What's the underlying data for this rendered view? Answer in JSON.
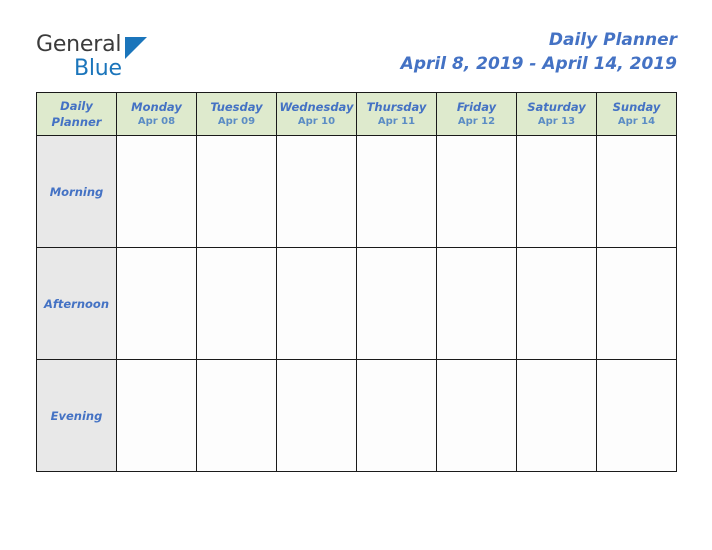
{
  "brand": {
    "logo_text_primary": "General",
    "logo_text_secondary": "Blue",
    "logo_accent_color": "#1b75bb",
    "logo_primary_color": "#3b3b3b",
    "triangle_icon": "blue-triangle-icon"
  },
  "header": {
    "title": "Daily Planner",
    "date_range": "April 8, 2019 - April 14, 2019",
    "title_color": "#4472c4"
  },
  "table": {
    "corner_label_line1": "Daily",
    "corner_label_line2": "Planner",
    "header_background": "#deeacd",
    "row_label_background": "#e8e8e8",
    "border_color": "#1a1a1a",
    "columns": [
      {
        "day": "Monday",
        "date": "Apr 08"
      },
      {
        "day": "Tuesday",
        "date": "Apr 09"
      },
      {
        "day": "Wednesday",
        "date": "Apr 10"
      },
      {
        "day": "Thursday",
        "date": "Apr 11"
      },
      {
        "day": "Friday",
        "date": "Apr 12"
      },
      {
        "day": "Saturday",
        "date": "Apr 13"
      },
      {
        "day": "Sunday",
        "date": "Apr 14"
      }
    ],
    "rows": [
      {
        "label": "Morning"
      },
      {
        "label": "Afternoon"
      },
      {
        "label": "Evening"
      }
    ]
  }
}
